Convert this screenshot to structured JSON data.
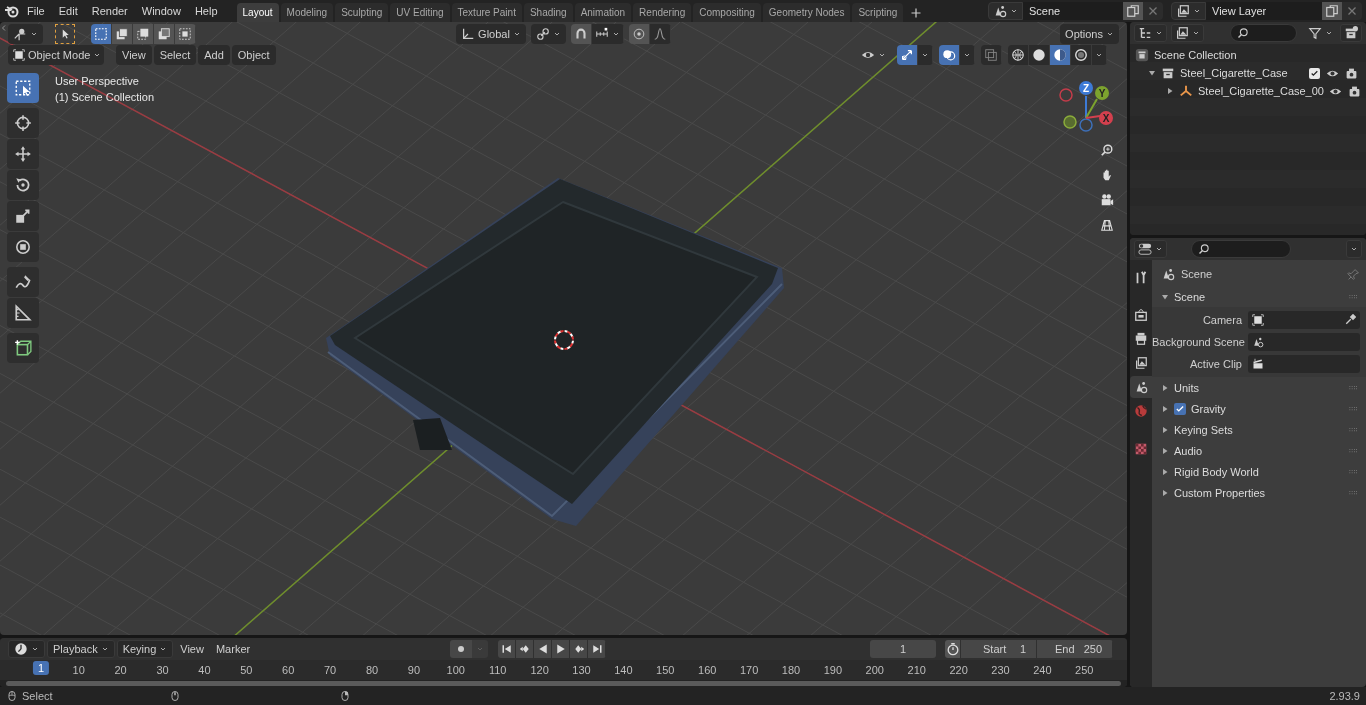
{
  "menu": [
    "File",
    "Edit",
    "Render",
    "Window",
    "Help"
  ],
  "workspaces": [
    {
      "label": "Layout",
      "selected": true
    },
    {
      "label": "Modeling",
      "selected": false
    },
    {
      "label": "Sculpting",
      "selected": false
    },
    {
      "label": "UV Editing",
      "selected": false
    },
    {
      "label": "Texture Paint",
      "selected": false
    },
    {
      "label": "Shading",
      "selected": false
    },
    {
      "label": "Animation",
      "selected": false
    },
    {
      "label": "Rendering",
      "selected": false
    },
    {
      "label": "Compositing",
      "selected": false
    },
    {
      "label": "Geometry Nodes",
      "selected": false
    },
    {
      "label": "Scripting",
      "selected": false
    }
  ],
  "scene": {
    "name": "Scene"
  },
  "view_layer": {
    "name": "View Layer"
  },
  "viewport": {
    "mode": "Object Mode",
    "menus": [
      "View",
      "Select",
      "Add",
      "Object"
    ],
    "orientation": "Global",
    "options": "Options",
    "overlay_lines": [
      "User Perspective",
      "(1) Scene Collection"
    ],
    "select_modes": [
      {
        "selected": true
      },
      {
        "selected": false
      },
      {
        "selected": false
      },
      {
        "selected": false
      },
      {
        "selected": false
      }
    ],
    "toggles": [
      {
        "kind": "gizmos",
        "on": true
      },
      {
        "kind": "overlays",
        "on": true
      },
      {
        "kind": "xray",
        "on": false
      }
    ],
    "shading": [
      {
        "selected": false
      },
      {
        "selected": false
      },
      {
        "selected": true
      },
      {
        "selected": false
      }
    ],
    "tools": [
      {
        "kind": "select",
        "selected": true
      },
      {
        "kind": "cursor",
        "selected": false
      },
      {
        "kind": "move",
        "selected": false
      },
      {
        "kind": "rotate",
        "selected": false
      },
      {
        "kind": "scale",
        "selected": false
      },
      {
        "kind": "transform",
        "selected": false
      },
      {
        "kind": "annotate",
        "selected": false
      },
      {
        "kind": "measure",
        "selected": false
      },
      {
        "kind": "add-cube",
        "selected": false
      }
    ],
    "gizmo_axes": [
      "Z",
      "Y",
      "X"
    ]
  },
  "outliner": {
    "items": [
      {
        "label": "Scene Collection",
        "kind": "scene-collection",
        "children": [
          {
            "label": "Steel_Cigarette_Case",
            "kind": "collection",
            "expanded": true,
            "checked": true,
            "children": [
              {
                "label": "Steel_Cigarette_Case_00",
                "kind": "empty",
                "expanded": false
              }
            ]
          }
        ]
      }
    ]
  },
  "properties": {
    "tabs": [
      {
        "kind": "tool",
        "selected": false
      },
      {
        "kind": "render",
        "selected": false
      },
      {
        "kind": "output",
        "selected": false
      },
      {
        "kind": "view-layer",
        "selected": false
      },
      {
        "kind": "scene",
        "selected": true
      },
      {
        "kind": "world",
        "selected": false
      },
      {
        "kind": "texture",
        "selected": false
      }
    ],
    "context": "Scene",
    "panels": [
      {
        "label": "Scene",
        "expanded": true,
        "fields": [
          {
            "label": "Camera",
            "kind": "camera"
          },
          {
            "label": "Background Scene",
            "kind": "scene"
          },
          {
            "label": "Active Clip",
            "kind": "clip"
          }
        ]
      },
      {
        "label": "Units",
        "expanded": false
      },
      {
        "label": "Gravity",
        "expanded": false,
        "checked": true
      },
      {
        "label": "Keying Sets",
        "expanded": false
      },
      {
        "label": "Audio",
        "expanded": false
      },
      {
        "label": "Rigid Body World",
        "expanded": false
      },
      {
        "label": "Custom Properties",
        "expanded": false
      }
    ]
  },
  "timeline": {
    "menus": [
      {
        "label": "Playback",
        "kind": "dropdown"
      },
      {
        "label": "Keying",
        "kind": "dropdown"
      },
      {
        "label": "View",
        "kind": "plain"
      },
      {
        "label": "Marker",
        "kind": "plain"
      }
    ],
    "current_frame": "1",
    "start_label": "Start",
    "start": "1",
    "end_label": "End",
    "end": "250",
    "playhead": "1",
    "ruler": [
      "10",
      "20",
      "30",
      "40",
      "50",
      "60",
      "70",
      "80",
      "90",
      "100",
      "110",
      "120",
      "130",
      "140",
      "150",
      "160",
      "170",
      "180",
      "190",
      "200",
      "210",
      "220",
      "230",
      "240",
      "250"
    ]
  },
  "status_bar": {
    "left": "Select",
    "version": "2.93.9"
  }
}
